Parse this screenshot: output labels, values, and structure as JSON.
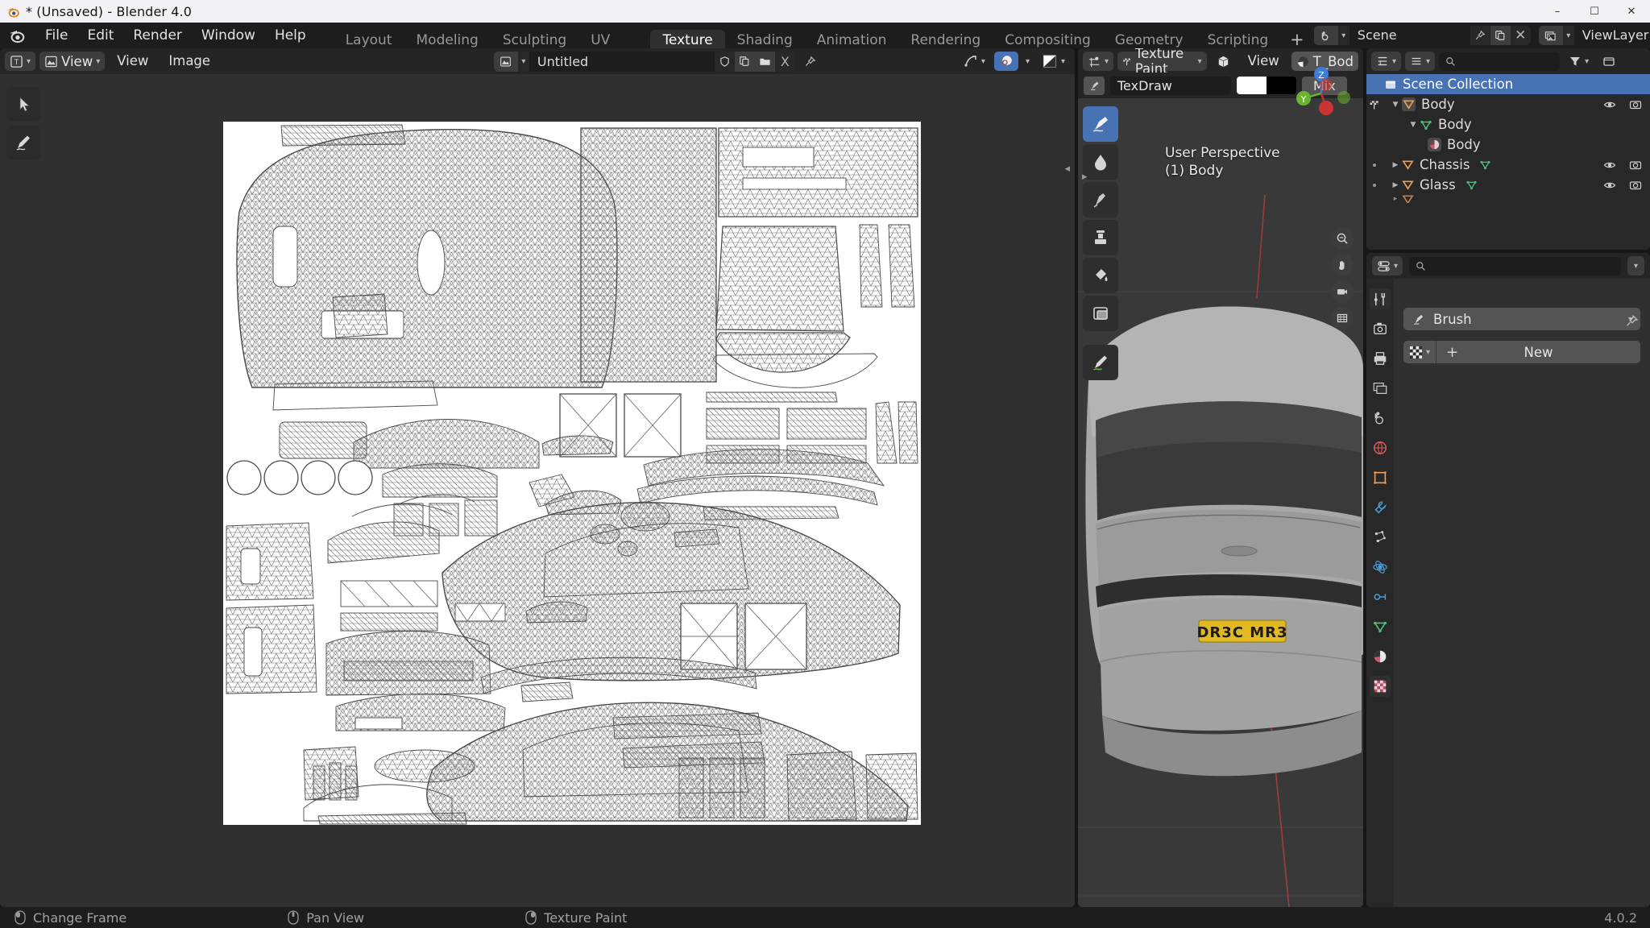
{
  "window": {
    "title": "* (Unsaved) - Blender 4.0",
    "app_icon": "blender-logo-icon",
    "minimize": "–",
    "maximize": "☐",
    "close": "✕"
  },
  "topbar": {
    "menus": [
      "File",
      "Edit",
      "Render",
      "Window",
      "Help"
    ],
    "workspaces": [
      {
        "label": "Layout",
        "active": false
      },
      {
        "label": "Modeling",
        "active": false
      },
      {
        "label": "Sculpting",
        "active": false
      },
      {
        "label": "UV Editing",
        "active": false
      },
      {
        "label": "Texture Paint",
        "active": true
      },
      {
        "label": "Shading",
        "active": false
      },
      {
        "label": "Animation",
        "active": false
      },
      {
        "label": "Rendering",
        "active": false
      },
      {
        "label": "Compositing",
        "active": false
      },
      {
        "label": "Geometry Nodes",
        "active": false
      },
      {
        "label": "Scripting",
        "active": false
      }
    ],
    "add_workspace": "+",
    "scene": {
      "icon": "scene-icon",
      "name": "Scene",
      "pin": "pin-icon",
      "duplicate": "copy-icon",
      "unlink": "✕"
    },
    "viewlayer": {
      "icon": "viewlayer-icon",
      "name": "ViewLayer",
      "duplicate": "copy-icon",
      "unlink": "✕"
    }
  },
  "image_editor": {
    "mode_icon": "uv-editor-mode-icon",
    "view_dropdown": "View",
    "menus": [
      "View",
      "Image"
    ],
    "image_datablock": {
      "browse_icon": "image-browse-icon",
      "name": "Untitled",
      "fake_user": "shield-icon",
      "new": "copy-icon",
      "open": "folder-icon",
      "unlink": "X",
      "pin": "pin-icon"
    },
    "right_toggles": [
      {
        "name": "snap-uv-icon",
        "active": false
      },
      {
        "name": "uv-sync-icon",
        "active": true
      },
      {
        "name": "display-channels-icon",
        "active": false
      }
    ],
    "tools": [
      {
        "name": "tweak-tool",
        "icon": "cursor-icon",
        "active": false
      },
      {
        "name": "annotate-tool",
        "icon": "pencil-icon",
        "active": false
      }
    ]
  },
  "viewport": {
    "mode_icon": "texture-paint-mode-icon",
    "mode_label": "Texture Paint",
    "object_icon": "object-icon",
    "menus": [
      "View"
    ],
    "material_label": "T_Bod",
    "brush": {
      "icon": "brush-icon",
      "name": "TexDraw",
      "color_primary": "#ffffff",
      "color_secondary": "#000000",
      "blend_mode": "Mix"
    },
    "overlay": {
      "perspective": "User Perspective",
      "object": "(1) Body"
    },
    "gizmo_axes": [
      "Z",
      "Y",
      "X"
    ],
    "nav_buttons": [
      "zoom-icon",
      "pan-hand-icon",
      "camera-icon",
      "ortho-persp-icon"
    ],
    "tools": [
      {
        "name": "draw-brush-tool",
        "active": true
      },
      {
        "name": "soften-tool",
        "active": false
      },
      {
        "name": "smear-tool",
        "active": false
      },
      {
        "name": "clone-tool",
        "active": false
      },
      {
        "name": "fill-tool",
        "active": false
      },
      {
        "name": "mask-tool",
        "active": false
      },
      {
        "name": "annotate-tool",
        "active": false
      }
    ],
    "license_plate": "DR3C MR3"
  },
  "outliner": {
    "filter_icon": "filter-icon",
    "display_mode_icon": "outliner-display-icon",
    "search_icon": "search-icon",
    "rows": [
      {
        "indent": 0,
        "label": "Scene Collection",
        "icon": "collection-icon",
        "selected": true,
        "expander": "",
        "visibility": false
      },
      {
        "indent": 1,
        "label": "Body",
        "icon": "object-mesh-icon",
        "selected": false,
        "expander": "▼",
        "visibility": true
      },
      {
        "indent": 2,
        "label": "Body",
        "icon": "mesh-data-icon",
        "selected": false,
        "expander": "▼",
        "visibility": false
      },
      {
        "indent": 3,
        "label": "Body",
        "icon": "material-icon",
        "selected": false,
        "expander": "",
        "visibility": false
      },
      {
        "indent": 1,
        "label": "Chassis",
        "icon": "object-mesh-icon",
        "selected": false,
        "expander": "▶",
        "visibility": true
      },
      {
        "indent": 1,
        "label": "Glass",
        "icon": "object-mesh-icon",
        "selected": false,
        "expander": "▶",
        "visibility": true
      }
    ],
    "visibility_icons": [
      "eye-icon",
      "camera-icon"
    ]
  },
  "properties": {
    "editor_icon": "properties-editor-icon",
    "search_placeholder": "",
    "search_icon": "search-icon",
    "options_chevron": "⌄",
    "pin_icon": "pin-icon",
    "tabs": [
      {
        "name": "tool-tab",
        "icon": "tool-icon",
        "active": true
      },
      {
        "name": "render-tab",
        "icon": "render-camera-icon",
        "active": false
      },
      {
        "name": "output-tab",
        "icon": "printer-icon",
        "active": false
      },
      {
        "name": "viewlayer-tab",
        "icon": "images-icon",
        "active": false
      },
      {
        "name": "scene-tab",
        "icon": "scene-cone-icon",
        "active": false
      },
      {
        "name": "world-tab",
        "icon": "world-globe-icon",
        "active": false
      },
      {
        "name": "object-tab",
        "icon": "orange-square-icon",
        "active": false
      },
      {
        "name": "modifier-tab",
        "icon": "wrench-icon",
        "active": false
      },
      {
        "name": "particles-tab",
        "icon": "particles-icon",
        "active": false
      },
      {
        "name": "physics-tab",
        "icon": "physics-orbit-icon",
        "active": false
      },
      {
        "name": "constraints-tab",
        "icon": "constraint-icon",
        "active": false
      },
      {
        "name": "data-tab",
        "icon": "green-triangle-data-icon",
        "active": false
      },
      {
        "name": "material-tab",
        "icon": "material-sphere-icon",
        "active": false
      },
      {
        "name": "texture-tab",
        "icon": "checker-texture-icon",
        "active": true
      }
    ],
    "brush_selector": {
      "icon": "brush-icon",
      "label": "Brush",
      "chevron": "⌄"
    },
    "texture_row": {
      "browse_icon": "checker-icon",
      "chevron": "⌄",
      "plus": "+",
      "new_label": "New"
    }
  },
  "statusbar": {
    "items": [
      {
        "icon": "mouse-left-icon",
        "label": "Change Frame"
      },
      {
        "icon": "mouse-middle-icon",
        "label": "Pan View"
      },
      {
        "icon": "mouse-right-icon",
        "label": "Texture Paint"
      }
    ],
    "version": "4.0.2"
  },
  "colors": {
    "accent_blue": "#4772b3",
    "header": "#252525",
    "editor_bg": "#303030",
    "outliner_bg": "#282828",
    "orange": "#ed9e5c",
    "green": "#4ec07e",
    "plate_yellow": "#e3b923"
  }
}
